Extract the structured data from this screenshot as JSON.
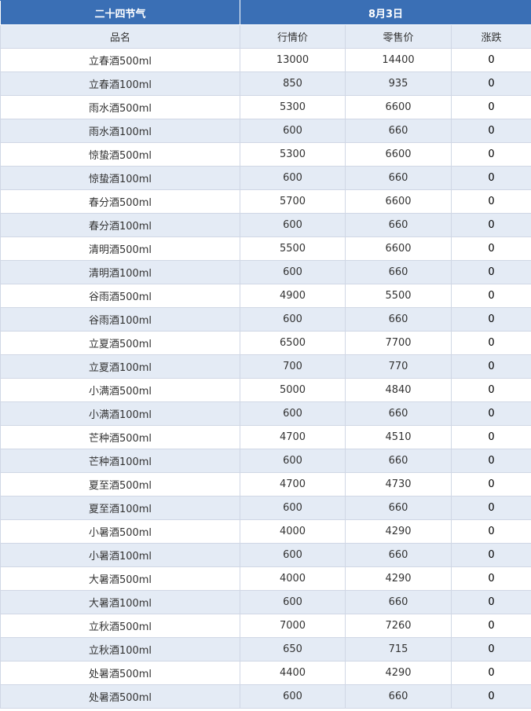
{
  "header": {
    "group_label": "二十四节气",
    "date_label": "8月3日",
    "columns": [
      "品名",
      "行情价",
      "零售价",
      "涨跌"
    ]
  },
  "rows": [
    {
      "name": "立春酒500ml",
      "market": "13000",
      "retail": "14400",
      "change": "0"
    },
    {
      "name": "立春酒100ml",
      "market": "850",
      "retail": "935",
      "change": "0"
    },
    {
      "name": "雨水酒500ml",
      "market": "5300",
      "retail": "6600",
      "change": "0"
    },
    {
      "name": "雨水酒100ml",
      "market": "600",
      "retail": "660",
      "change": "0"
    },
    {
      "name": "惊蛰酒500ml",
      "market": "5300",
      "retail": "6600",
      "change": "0"
    },
    {
      "name": "惊蛰酒100ml",
      "market": "600",
      "retail": "660",
      "change": "0"
    },
    {
      "name": "春分酒500ml",
      "market": "5700",
      "retail": "6600",
      "change": "0"
    },
    {
      "name": "春分酒100ml",
      "market": "600",
      "retail": "660",
      "change": "0"
    },
    {
      "name": "清明酒500ml",
      "market": "5500",
      "retail": "6600",
      "change": "0"
    },
    {
      "name": "清明酒100ml",
      "market": "600",
      "retail": "660",
      "change": "0"
    },
    {
      "name": "谷雨酒500ml",
      "market": "4900",
      "retail": "5500",
      "change": "0"
    },
    {
      "name": "谷雨酒100ml",
      "market": "600",
      "retail": "660",
      "change": "0"
    },
    {
      "name": "立夏酒500ml",
      "market": "6500",
      "retail": "7700",
      "change": "0"
    },
    {
      "name": "立夏酒100ml",
      "market": "700",
      "retail": "770",
      "change": "0"
    },
    {
      "name": "小满酒500ml",
      "market": "5000",
      "retail": "4840",
      "change": "0"
    },
    {
      "name": "小满酒100ml",
      "market": "600",
      "retail": "660",
      "change": "0"
    },
    {
      "name": "芒种酒500ml",
      "market": "4700",
      "retail": "4510",
      "change": "0"
    },
    {
      "name": "芒种酒100ml",
      "market": "600",
      "retail": "660",
      "change": "0"
    },
    {
      "name": "夏至酒500ml",
      "market": "4700",
      "retail": "4730",
      "change": "0"
    },
    {
      "name": "夏至酒100ml",
      "market": "600",
      "retail": "660",
      "change": "0"
    },
    {
      "name": "小暑酒500ml",
      "market": "4000",
      "retail": "4290",
      "change": "0"
    },
    {
      "name": "小暑酒100ml",
      "market": "600",
      "retail": "660",
      "change": "0"
    },
    {
      "name": "大暑酒500ml",
      "market": "4000",
      "retail": "4290",
      "change": "0"
    },
    {
      "name": "大暑酒100ml",
      "market": "600",
      "retail": "660",
      "change": "0"
    },
    {
      "name": "立秋酒500ml",
      "market": "7000",
      "retail": "7260",
      "change": "0"
    },
    {
      "name": "立秋酒100ml",
      "market": "650",
      "retail": "715",
      "change": "0"
    },
    {
      "name": "处暑酒500ml",
      "market": "4400",
      "retail": "4290",
      "change": "0"
    },
    {
      "name": "处暑酒500ml",
      "market": "600",
      "retail": "660",
      "change": "0"
    }
  ]
}
